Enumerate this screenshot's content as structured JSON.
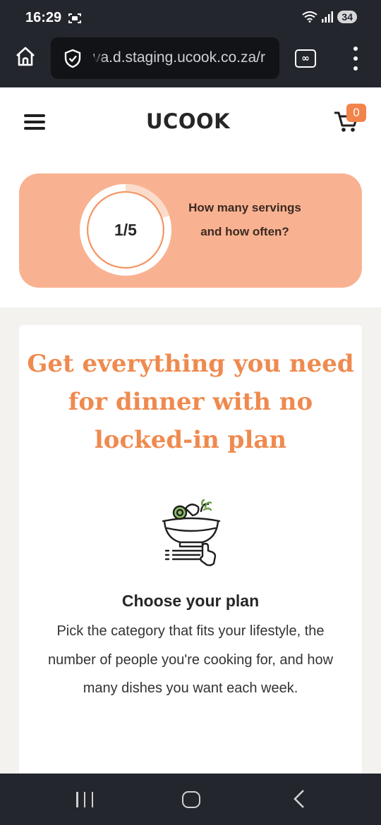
{
  "status_bar": {
    "time": "16:29",
    "battery": "34"
  },
  "browser": {
    "url": "va.d.staging.ucook.co.za/r",
    "tabs_icon": "infinity-tabs-icon"
  },
  "header": {
    "logo": "UCOOK",
    "cart_count": "0"
  },
  "progress": {
    "step": "1/5",
    "title": "How many servings and how often?",
    "fraction": 0.2
  },
  "hero": {
    "headline": "Get everything you need for dinner with no locked-in plan"
  },
  "plan": {
    "title": "Choose your plan",
    "description": "Pick the category that fits your lifestyle, the number of people you're cooking for, and how many dishes you want each week."
  },
  "colors": {
    "accent": "#ef8a4f",
    "progress_card": "#f9b291",
    "chrome": "#24262e"
  }
}
